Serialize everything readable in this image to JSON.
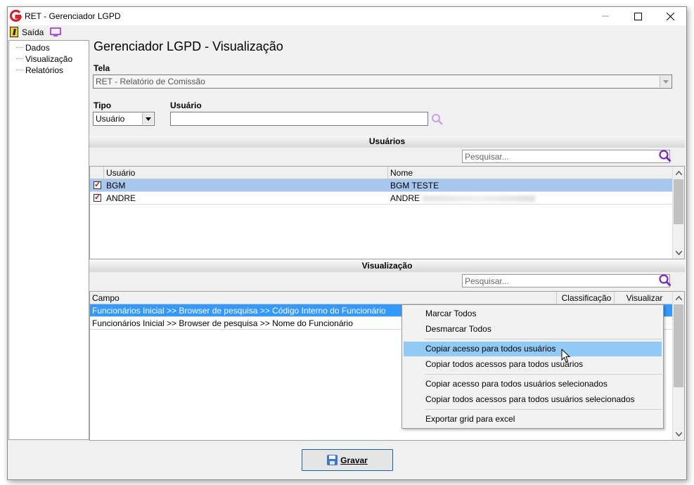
{
  "window": {
    "title": "RET - Gerenciador LGPD",
    "minimize": "—",
    "maximize": "☐",
    "close": "✕"
  },
  "menubar": {
    "exit_label": "Saída"
  },
  "tree": {
    "items": [
      "Dados",
      "Visualização",
      "Relatórios"
    ]
  },
  "content": {
    "title": "Gerenciador LGPD - Visualização",
    "tela_label": "Tela",
    "tela_value": "RET - Relatório de Comissão",
    "tipo_label": "Tipo",
    "tipo_value": "Usuário",
    "usuario_label": "Usuário",
    "usuario_value": ""
  },
  "users_section": {
    "header": "Usuários",
    "search_placeholder": "Pesquisar...",
    "columns": [
      "Usuário",
      "Nome"
    ],
    "rows": [
      {
        "checked": true,
        "usuario": "BGM",
        "nome": "BGM TESTE"
      },
      {
        "checked": true,
        "usuario": "ANDRE",
        "nome": "ANDRE"
      }
    ]
  },
  "view_section": {
    "header": "Visualização",
    "search_placeholder": "Pesquisar...",
    "columns": [
      "Campo",
      "Classificação",
      "Visualizar"
    ],
    "rows": [
      {
        "campo": "Funcionários Inicial >> Browser de pesquisa >> Código Interno do Funcionário"
      },
      {
        "campo": "Funcionários Inicial >> Browser de pesquisa >> Nome do Funcionário"
      }
    ]
  },
  "context_menu": {
    "items": [
      "Marcar Todos",
      "Desmarcar Todos",
      "Copiar acesso para todos usuários",
      "Copiar todos acessos para todos usuários",
      "Copiar acesso para todos usuários selecionados",
      "Copiar todos acessos para todos usuários selecionados",
      "Exportar grid para excel"
    ],
    "hovered_index": 2
  },
  "footer": {
    "save_label": "Gravar"
  },
  "colors": {
    "selection": "#3399ff",
    "row_highlight": "#a6c8f0",
    "menu_hover": "#91c9f7",
    "accent_purple": "#9b30d9"
  }
}
